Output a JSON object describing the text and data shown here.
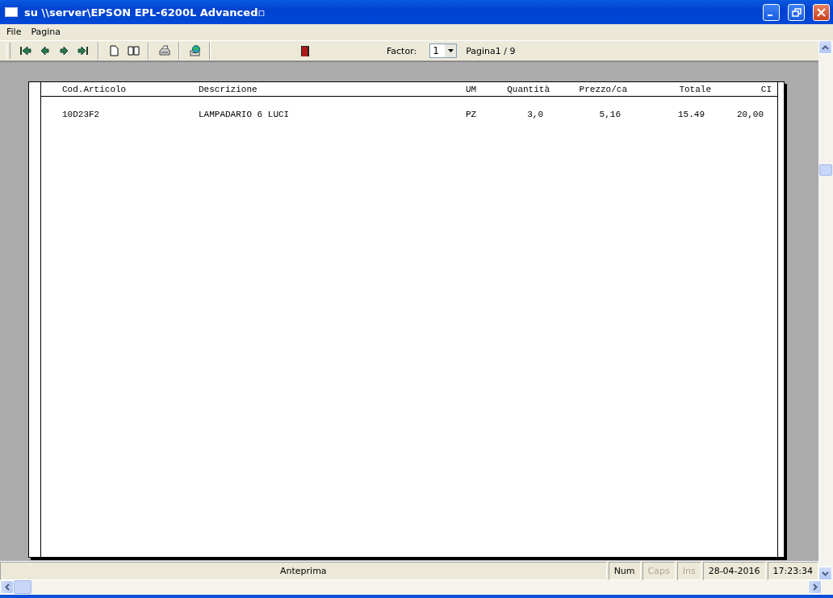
{
  "window": {
    "title": "su \\\\server\\EPSON EPL-6200L Advanced▫"
  },
  "menu": [
    "File",
    "Pagina"
  ],
  "toolbar": {
    "factor_label": "Factor:",
    "factor_value": "1",
    "page_label": "Pagina1 / 9"
  },
  "report": {
    "columns": [
      "Cod.Articolo",
      "Descrizione",
      "UM",
      "Quantità",
      "Prezzo/ca",
      "Totale",
      "CI"
    ],
    "rows": [
      {
        "cells": [
          "10D23F2",
          "LAMPADARIO 6 LUCI",
          "PZ",
          "3,0",
          "5,16",
          "15.49",
          "20,00"
        ]
      }
    ]
  },
  "status_bar": {
    "message": "Anteprima",
    "indicators": [
      {
        "label": "Num",
        "disabled": false
      },
      {
        "label": "Caps",
        "disabled": true
      },
      {
        "label": "Ins",
        "disabled": true
      }
    ],
    "date": "28-04-2016",
    "time": "17:23:34"
  }
}
